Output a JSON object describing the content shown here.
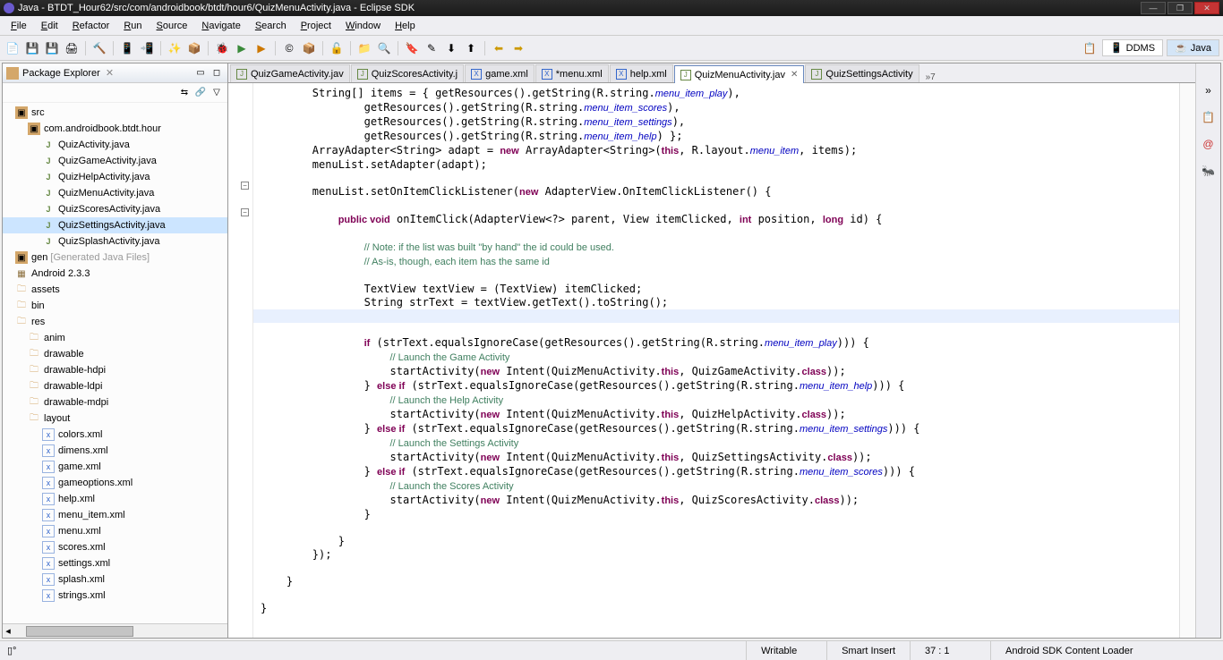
{
  "window": {
    "title": "Java - BTDT_Hour62/src/com/androidbook/btdt/hour6/QuizMenuActivity.java - Eclipse SDK"
  },
  "menubar": [
    "File",
    "Edit",
    "Refactor",
    "Run",
    "Source",
    "Navigate",
    "Search",
    "Project",
    "Window",
    "Help"
  ],
  "perspectives": {
    "ddms": "DDMS",
    "java": "Java"
  },
  "package_explorer": {
    "title": "Package Explorer",
    "tree": [
      {
        "icon": "pkg",
        "indent": 10,
        "label": "src"
      },
      {
        "icon": "pkg-dot",
        "indent": 24,
        "label": "com.androidbook.btdt.hour"
      },
      {
        "icon": "java",
        "indent": 40,
        "label": "QuizActivity.java"
      },
      {
        "icon": "java",
        "indent": 40,
        "label": "QuizGameActivity.java"
      },
      {
        "icon": "java",
        "indent": 40,
        "label": "QuizHelpActivity.java"
      },
      {
        "icon": "java",
        "indent": 40,
        "label": "QuizMenuActivity.java"
      },
      {
        "icon": "java",
        "indent": 40,
        "label": "QuizScoresActivity.java"
      },
      {
        "icon": "java",
        "indent": 40,
        "label": "QuizSettingsActivity.java",
        "selected": true
      },
      {
        "icon": "java",
        "indent": 40,
        "label": "QuizSplashActivity.java"
      },
      {
        "icon": "pkg",
        "indent": 10,
        "label": "gen [Generated Java Files]",
        "gen": true
      },
      {
        "icon": "jar",
        "indent": 10,
        "label": "Android 2.3.3"
      },
      {
        "icon": "folder",
        "indent": 10,
        "label": "assets"
      },
      {
        "icon": "folder",
        "indent": 10,
        "label": "bin"
      },
      {
        "icon": "folder-open",
        "indent": 10,
        "label": "res"
      },
      {
        "icon": "folder-open",
        "indent": 24,
        "label": "anim"
      },
      {
        "icon": "folder-open",
        "indent": 24,
        "label": "drawable"
      },
      {
        "icon": "folder-open",
        "indent": 24,
        "label": "drawable-hdpi"
      },
      {
        "icon": "folder-open",
        "indent": 24,
        "label": "drawable-ldpi"
      },
      {
        "icon": "folder-open",
        "indent": 24,
        "label": "drawable-mdpi"
      },
      {
        "icon": "folder-open",
        "indent": 24,
        "label": "layout"
      },
      {
        "icon": "xml",
        "indent": 40,
        "label": "colors.xml"
      },
      {
        "icon": "xml",
        "indent": 40,
        "label": "dimens.xml"
      },
      {
        "icon": "xml",
        "indent": 40,
        "label": "game.xml"
      },
      {
        "icon": "xml",
        "indent": 40,
        "label": "gameoptions.xml"
      },
      {
        "icon": "xml",
        "indent": 40,
        "label": "help.xml"
      },
      {
        "icon": "xml",
        "indent": 40,
        "label": "menu_item.xml"
      },
      {
        "icon": "xml",
        "indent": 40,
        "label": "menu.xml"
      },
      {
        "icon": "xml",
        "indent": 40,
        "label": "scores.xml"
      },
      {
        "icon": "xml",
        "indent": 40,
        "label": "settings.xml"
      },
      {
        "icon": "xml",
        "indent": 40,
        "label": "splash.xml"
      },
      {
        "icon": "xml",
        "indent": 40,
        "label": "strings.xml"
      }
    ]
  },
  "editor_tabs": [
    {
      "icon": "J",
      "label": "QuizGameActivity.jav"
    },
    {
      "icon": "J",
      "label": "QuizScoresActivity.j"
    },
    {
      "icon": "X",
      "label": "game.xml"
    },
    {
      "icon": "X",
      "label": "*menu.xml"
    },
    {
      "icon": "X",
      "label": "help.xml"
    },
    {
      "icon": "J",
      "label": "QuizMenuActivity.jav",
      "active": true
    },
    {
      "icon": "J",
      "label": "QuizSettingsActivity"
    }
  ],
  "tab_overflow": "»7",
  "code_lines": [
    "        String[] items = { getResources().getString(R.string.<i>menu_item_play</i>),",
    "                getResources().getString(R.string.<i>menu_item_scores</i>),",
    "                getResources().getString(R.string.<i>menu_item_settings</i>),",
    "                getResources().getString(R.string.<i>menu_item_help</i>) };",
    "        ArrayAdapter&lt;String&gt; adapt = <b>new</b> ArrayAdapter&lt;String&gt;(<b>this</b>, R.layout.<i>menu_item</i>, items);",
    "        menuList.setAdapter(adapt);",
    "",
    "        menuList.setOnItemClickListener(<b>new</b> AdapterView.OnItemClickListener() {",
    "",
    "            <b>public void</b> onItemClick(AdapterView&lt;?&gt; parent, View itemClicked, <b>int</b> position, <b>long</b> id) {",
    "",
    "                <c>// Note: if the list was built \"by hand\" the id could be used.</c>",
    "                <c>// As-is, though, each item has the same id</c>",
    "",
    "                TextView textView = (TextView) itemClicked;",
    "                String strText = textView.getText().toString();",
    "<hl></hl>",
    "                <b>if</b> (strText.equalsIgnoreCase(getResources().getString(R.string.<i>menu_item_play</i>))) {",
    "                    <c>// Launch the Game Activity</c>",
    "                    startActivity(<b>new</b> Intent(QuizMenuActivity.<b>this</b>, QuizGameActivity.<b>class</b>));",
    "                } <b>else if</b> (strText.equalsIgnoreCase(getResources().getString(R.string.<i>menu_item_help</i>))) {",
    "                    <c>// Launch the Help Activity</c>",
    "                    startActivity(<b>new</b> Intent(QuizMenuActivity.<b>this</b>, QuizHelpActivity.<b>class</b>));",
    "                } <b>else if</b> (strText.equalsIgnoreCase(getResources().getString(R.string.<i>menu_item_settings</i>))) {",
    "                    <c>// Launch the Settings Activity</c>",
    "                    startActivity(<b>new</b> Intent(QuizMenuActivity.<b>this</b>, QuizSettingsActivity.<b>class</b>));",
    "                } <b>else if</b> (strText.equalsIgnoreCase(getResources().getString(R.string.<i>menu_item_scores</i>))) {",
    "                    <c>// Launch the Scores Activity</c>",
    "                    startActivity(<b>new</b> Intent(QuizMenuActivity.<b>this</b>, QuizScoresActivity.<b>class</b>));",
    "                }",
    "",
    "            }",
    "        });",
    "",
    "    }",
    "",
    "}"
  ],
  "status": {
    "writable": "Writable",
    "insert": "Smart Insert",
    "pos": "37 : 1",
    "loader": "Android SDK Content Loader"
  }
}
